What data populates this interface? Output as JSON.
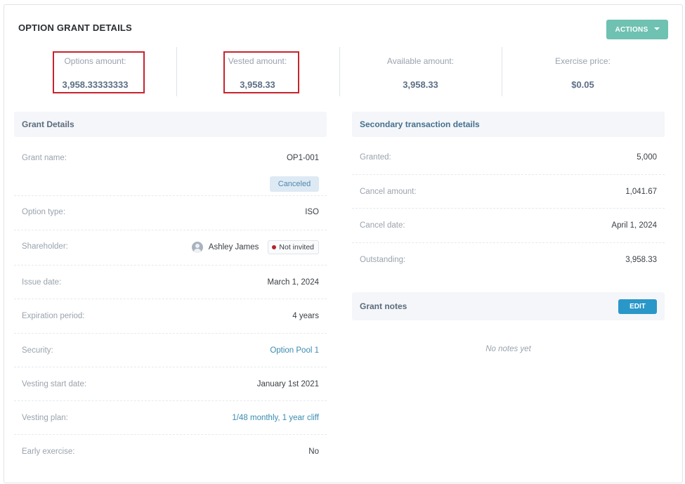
{
  "header": {
    "title": "OPTION GRANT DETAILS",
    "actions_label": "ACTIONS"
  },
  "stats": [
    {
      "label": "Options amount:",
      "value": "3,958.33333333"
    },
    {
      "label": "Vested amount:",
      "value": "3,958.33"
    },
    {
      "label": "Available amount:",
      "value": "3,958.33"
    },
    {
      "label": "Exercise price:",
      "value": "$0.05"
    }
  ],
  "grant_details": {
    "title": "Grant Details",
    "grant_name": {
      "label": "Grant name:",
      "value": "OP1-001",
      "status": "Canceled"
    },
    "option_type": {
      "label": "Option type:",
      "value": "ISO"
    },
    "shareholder": {
      "label": "Shareholder:",
      "name": "Ashley James",
      "status": "Not invited"
    },
    "issue_date": {
      "label": "Issue date:",
      "value": "March 1, 2024"
    },
    "expiration_period": {
      "label": "Expiration period:",
      "value": "4 years"
    },
    "security": {
      "label": "Security:",
      "value": "Option Pool 1"
    },
    "vesting_start_date": {
      "label": "Vesting start date:",
      "value": "January 1st 2021"
    },
    "vesting_plan": {
      "label": "Vesting plan:",
      "value": "1/48 monthly, 1 year cliff"
    },
    "early_exercise": {
      "label": "Early exercise:",
      "value": "No"
    }
  },
  "secondary": {
    "title": "Secondary transaction details",
    "rows": [
      {
        "label": "Granted:",
        "value": "5,000"
      },
      {
        "label": "Cancel amount:",
        "value": "1,041.67"
      },
      {
        "label": "Cancel date:",
        "value": "April 1, 2024"
      },
      {
        "label": "Outstanding:",
        "value": "3,958.33"
      }
    ]
  },
  "notes": {
    "title": "Grant notes",
    "edit_label": "EDIT",
    "empty_text": "No notes yet"
  },
  "colors": {
    "accent_teal": "#6fc1b1",
    "edit_blue": "#2a97c9",
    "highlight_red": "#c8232c",
    "link": "#3a8bb0"
  }
}
